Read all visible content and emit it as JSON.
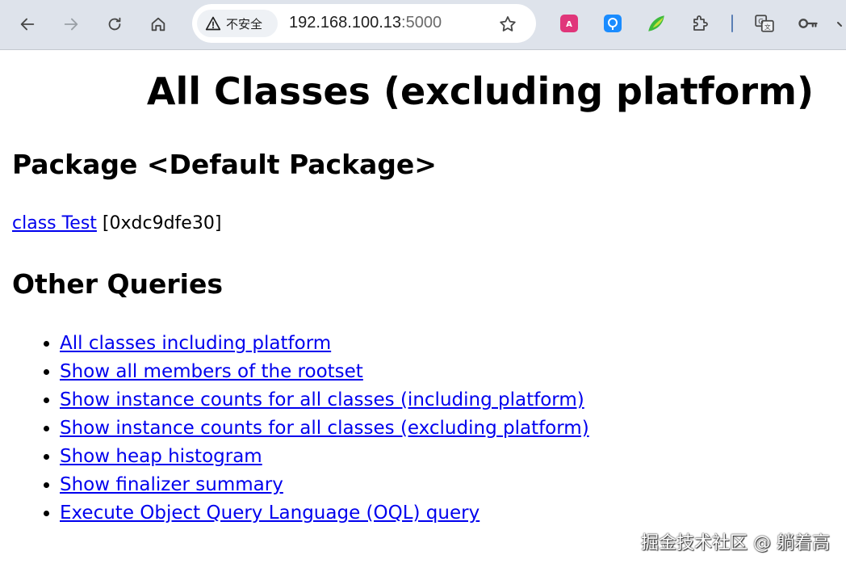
{
  "browser": {
    "security_label": "不安全",
    "url_host": "192.168.100.13",
    "url_port": ":5000"
  },
  "page": {
    "title": "All Classes (excluding platform)",
    "package_heading": "Package <Default Package>",
    "class_link": "class Test",
    "class_address": " [0xdc9dfe30]",
    "other_queries_heading": "Other Queries",
    "queries": [
      "All classes including platform",
      "Show all members of the rootset",
      "Show instance counts for all classes (including platform)",
      "Show instance counts for all classes (excluding platform)",
      "Show heap histogram",
      "Show finalizer summary",
      "Execute Object Query Language (OQL) query"
    ]
  },
  "watermark": "掘金技术社区 @ 躺着高",
  "colors": {
    "link": "#0000ee",
    "toolbar_bg": "#dee3eb"
  },
  "icons": [
    "back-icon",
    "forward-icon",
    "reload-icon",
    "home-icon",
    "warning-icon",
    "star-icon",
    "translate-extension-icon",
    "pin-extension-icon",
    "leaf-extension-icon",
    "extensions-puzzle-icon",
    "google-translate-icon",
    "password-key-icon"
  ]
}
